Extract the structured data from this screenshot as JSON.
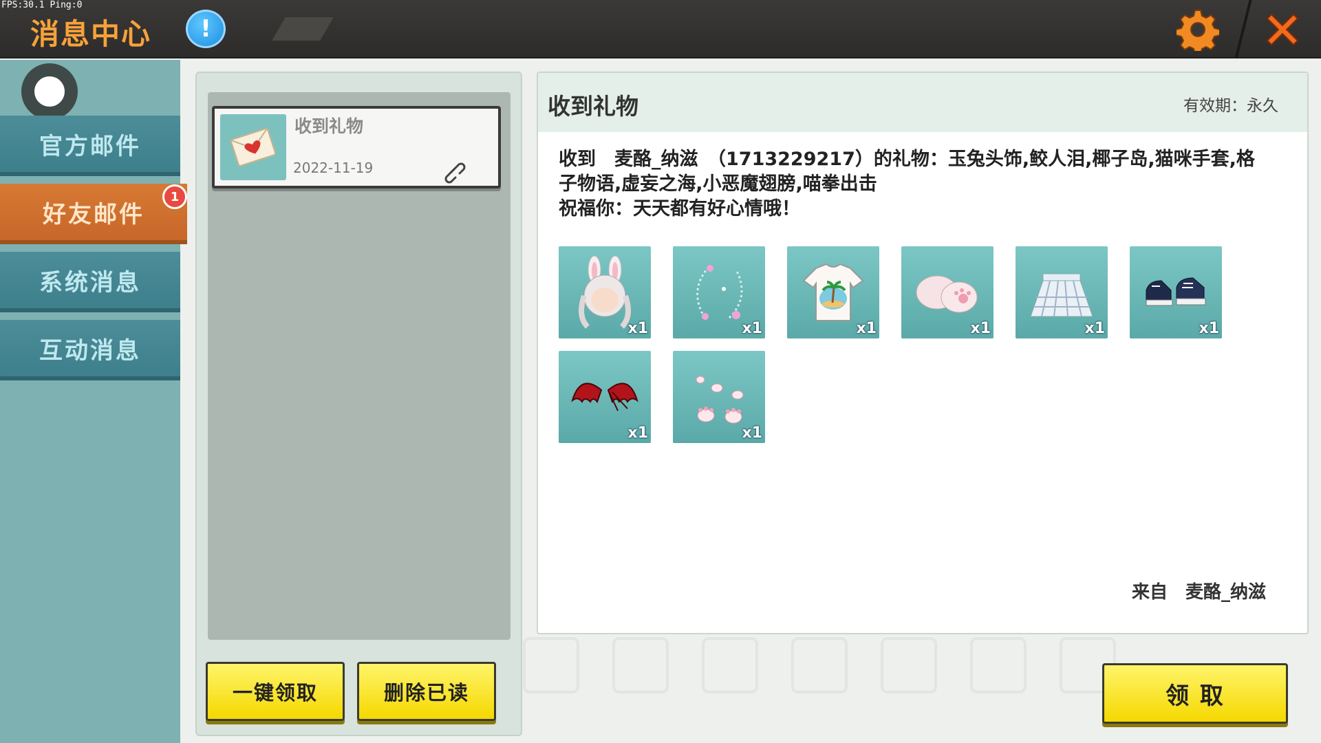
{
  "status": {
    "fps_text": "FPS:30.1  Ping:0"
  },
  "header": {
    "title": "消息中心",
    "info_icon": "exclamation-icon",
    "settings_icon": "gear-icon",
    "close_icon": "close-icon"
  },
  "sidebar": {
    "avatar_icon": "avatar-circle",
    "items": [
      {
        "label": "官方邮件",
        "active": false
      },
      {
        "label": "好友邮件",
        "active": true,
        "badge": "1"
      },
      {
        "label": "系统消息",
        "active": false
      },
      {
        "label": "互动消息",
        "active": false
      }
    ]
  },
  "mail_list": {
    "items": [
      {
        "title": "收到礼物",
        "date": "2022-11-19",
        "icon": "envelope-icon",
        "attachment_icon": "link-icon"
      }
    ],
    "claim_all_label": "一键领取",
    "delete_read_label": "删除已读"
  },
  "detail": {
    "title": "收到礼物",
    "validity": "有效期：永久",
    "message_line1": "收到　麦酪_纳滋　（1713229217）的礼物：玉兔头饰,鲛人泪,椰子岛,猫咪手套,格子物语,虚妄之海,小恶魔翅膀,喵拳出击",
    "message_line2": "祝福你：天天都有好心情哦！",
    "gifts": [
      {
        "name": "bunny-hair-icon",
        "count": "x1"
      },
      {
        "name": "sparkle-ring-icon",
        "count": "x1"
      },
      {
        "name": "island-tshirt-icon",
        "count": "x1"
      },
      {
        "name": "cat-paw-gloves-icon",
        "count": "x1"
      },
      {
        "name": "plaid-skirt-icon",
        "count": "x1"
      },
      {
        "name": "sneakers-icon",
        "count": "x1"
      },
      {
        "name": "devil-wings-icon",
        "count": "x1"
      },
      {
        "name": "paw-prints-icon",
        "count": "x1"
      }
    ],
    "sender": "来自　麦酪_纳滋",
    "claim_label": "领 取"
  },
  "colors": {
    "accent_orange": "#d77a33",
    "sidebar_teal": "#4c8d99",
    "button_yellow": "#f5d800",
    "badge_red": "#e94a3f"
  }
}
